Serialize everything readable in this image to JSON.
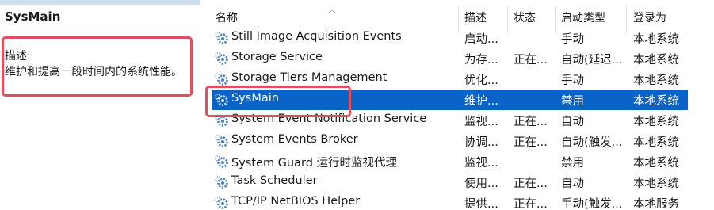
{
  "left_panel": {
    "service_title": "SysMain",
    "description_label": "描述:",
    "description_text": "维护和提高一段时间内的系统性能。"
  },
  "columns": {
    "name": "名称",
    "description": "描述",
    "status": "状态",
    "startup_type": "启动类型",
    "log_on_as": "登录为"
  },
  "services": [
    {
      "name": "Still Image Acquisition Events",
      "description": "启动...",
      "status": "",
      "startup_type": "手动",
      "log_on_as": "本地系统",
      "selected": false
    },
    {
      "name": "Storage Service",
      "description": "为存...",
      "status": "正在...",
      "startup_type": "自动(延迟...",
      "log_on_as": "本地系统",
      "selected": false
    },
    {
      "name": "Storage Tiers Management",
      "description": "优化...",
      "status": "",
      "startup_type": "手动",
      "log_on_as": "本地系统",
      "selected": false
    },
    {
      "name": "SysMain",
      "description": "维护...",
      "status": "",
      "startup_type": "禁用",
      "log_on_as": "本地系统",
      "selected": true
    },
    {
      "name": "System Event Notification Service",
      "description": "监视...",
      "status": "正在...",
      "startup_type": "自动",
      "log_on_as": "本地系统",
      "selected": false
    },
    {
      "name": "System Events Broker",
      "description": "协调...",
      "status": "正在...",
      "startup_type": "自动(触发...",
      "log_on_as": "本地系统",
      "selected": false
    },
    {
      "name": "System Guard 运行时监视代理",
      "description": "监视...",
      "status": "",
      "startup_type": "禁用",
      "log_on_as": "本地系统",
      "selected": false
    },
    {
      "name": "Task Scheduler",
      "description": "使用...",
      "status": "正在...",
      "startup_type": "自动",
      "log_on_as": "本地系统",
      "selected": false
    },
    {
      "name": "TCP/IP NetBIOS Helper",
      "description": "提供...",
      "status": "正在...",
      "startup_type": "手动(触发...",
      "log_on_as": "本地服务",
      "selected": false
    }
  ],
  "colors": {
    "selection": "#0a64c8",
    "annotation": "#e0505e",
    "gear": "#4a7fc1"
  },
  "icons": {
    "service_row": "gear-icon"
  }
}
